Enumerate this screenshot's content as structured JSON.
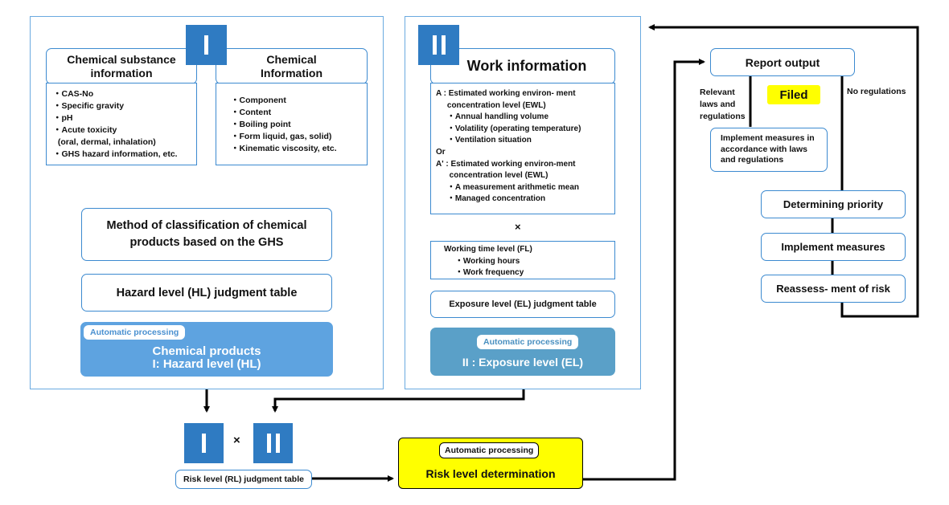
{
  "panel_one": {
    "numeral": "I",
    "chem_substance": {
      "title_line1": "Chemical substance",
      "title_line2": "information",
      "items": [
        "・CAS-No",
        "・Specific gravity",
        "・pH",
        "・Acute toxicity",
        "  (oral, dermal, inhalation)",
        "・GHS hazard information, etc."
      ]
    },
    "chem_info": {
      "title_line1": "Chemical",
      "title_line2": "Information",
      "items": [
        "・Component",
        "・Content",
        "・Boiling point",
        "・Form liquid, gas, solid)",
        "・Kinematic viscosity, etc."
      ]
    },
    "method_line1": "Method of classification of chemical",
    "method_line2": "products based on the GHS",
    "hazard_table": "Hazard level (HL) judgment table",
    "auto_label": "Automatic processing",
    "result_line1": "Chemical products",
    "result_line2": "I: Hazard level (HL)"
  },
  "panel_two": {
    "numeral": "II",
    "title": "Work information",
    "items": [
      "A : Estimated working environ- ment",
      "     concentration level (EWL)",
      "     ・Annual handling volume",
      "     ・Volatility (operating temperature)",
      "     ・Ventilation situation",
      "Or",
      "A' : Estimated working environ-ment",
      "      concentration level (EWL)",
      "     ・A measurement arithmetic mean",
      "     ・Managed concentration"
    ],
    "times": "×",
    "working_time": [
      "Working time level (FL)",
      "     ・Working hours",
      "     ・Work frequency"
    ],
    "exposure_table": "Exposure level (EL) judgment table",
    "auto_label": "Automatic processing",
    "result": "II : Exposure level (EL)"
  },
  "risk": {
    "numeral_one": "I",
    "numeral_two": "II",
    "times": "×",
    "table": "Risk level (RL) judgment table",
    "auto_label": "Automatic processing",
    "determination": "Risk level determination"
  },
  "report": {
    "output": "Report output",
    "relevant": [
      "Relevant",
      "laws and",
      "regulations"
    ],
    "filed": "Filed",
    "no_regulations": "No regulations",
    "implement_laws": [
      "Implement measures in",
      "accordance with laws",
      "and regulations"
    ],
    "priority": "Determining priority",
    "implement": "Implement measures",
    "reassess": "Reassess- ment of risk"
  },
  "colors": {
    "numeral_blue": "#2f7bc2",
    "hazard_blue": "#5ea3e0",
    "exposure_blue": "#5aa0c8",
    "highlight_yellow": "#ffff00"
  }
}
